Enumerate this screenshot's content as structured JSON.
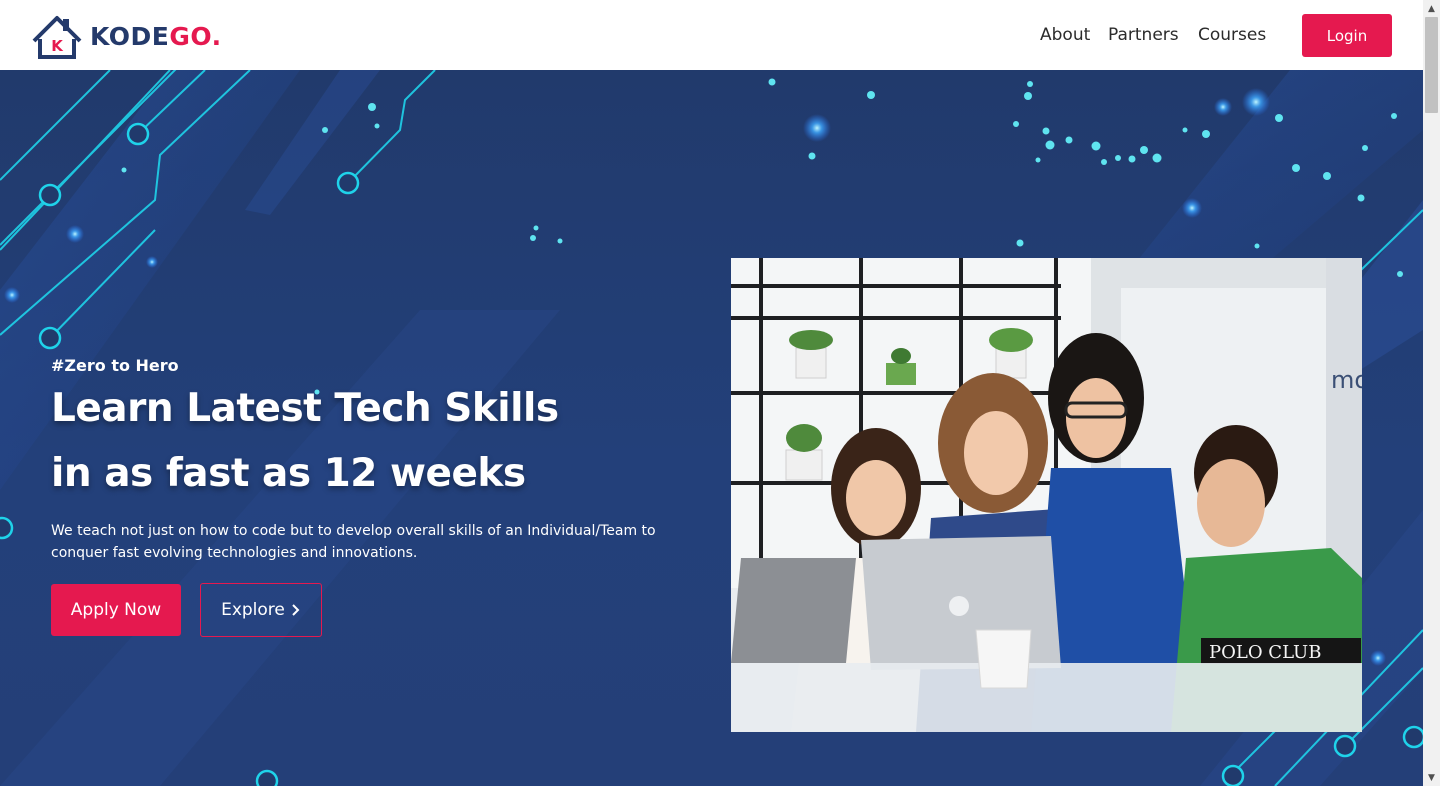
{
  "brand": {
    "name_main": "KODE",
    "name_accent": "GO.",
    "logo_letter": "K"
  },
  "nav": {
    "items": [
      "About",
      "Partners",
      "Courses"
    ],
    "login_label": "Login"
  },
  "hero": {
    "tagline": "#Zero to Hero",
    "headline_line1": "Learn Latest Tech Skills",
    "headline_line2": "in as fast as 12 weeks",
    "description": "We teach not just on how to code but to develop overall skills of an Individual/Team to conquer fast evolving technologies and innovations.",
    "apply_label": "Apply Now",
    "explore_label": "Explore",
    "explore_icon": "chevron-right-icon",
    "photo_overlay": {
      "shirt_text": "POLO CLUB",
      "wall_text": "mo"
    }
  },
  "colors": {
    "accent": "#e5194f",
    "brand_navy": "#243a6b",
    "hero_bg": "#213a6c",
    "circuit": "#1fd3ea"
  },
  "scrollbar": {
    "up_icon": "scroll-up-arrow-icon",
    "down_icon": "scroll-down-arrow-icon"
  }
}
